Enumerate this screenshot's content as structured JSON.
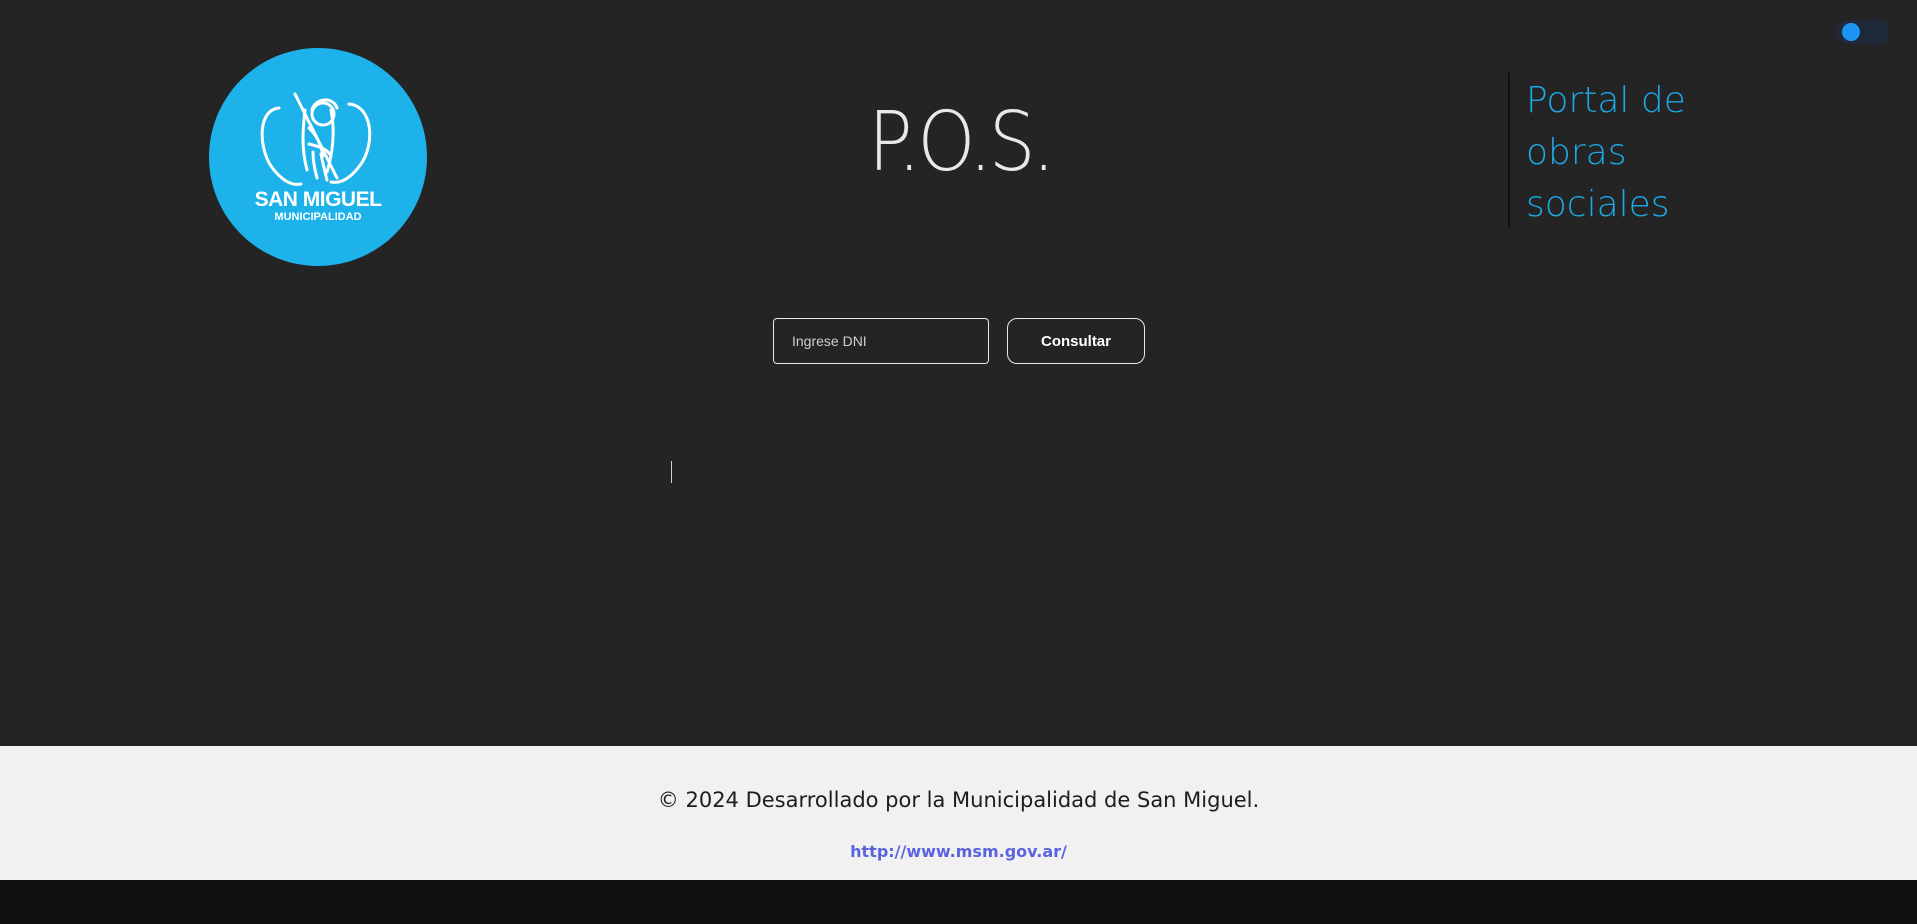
{
  "theme_toggle": {
    "knob_color": "#1d95f2",
    "track_color": "#1e2a3c"
  },
  "logo": {
    "title": "SAN MIGUEL",
    "subtitle": "MUNICIPALIDAD",
    "background": "#1db2ea"
  },
  "header": {
    "title": "P.O.S.",
    "portal_text": "Portal de obras sociales",
    "portal_color": "#1da8e8"
  },
  "search": {
    "placeholder": "Ingrese DNI",
    "value": "",
    "button_label": "Consultar"
  },
  "footer": {
    "copyright": "© 2024 Desarrollado por la Municipalidad de San Miguel.",
    "link_text": "http://www.msm.gov.ar/",
    "link_color": "#5a64e0"
  }
}
